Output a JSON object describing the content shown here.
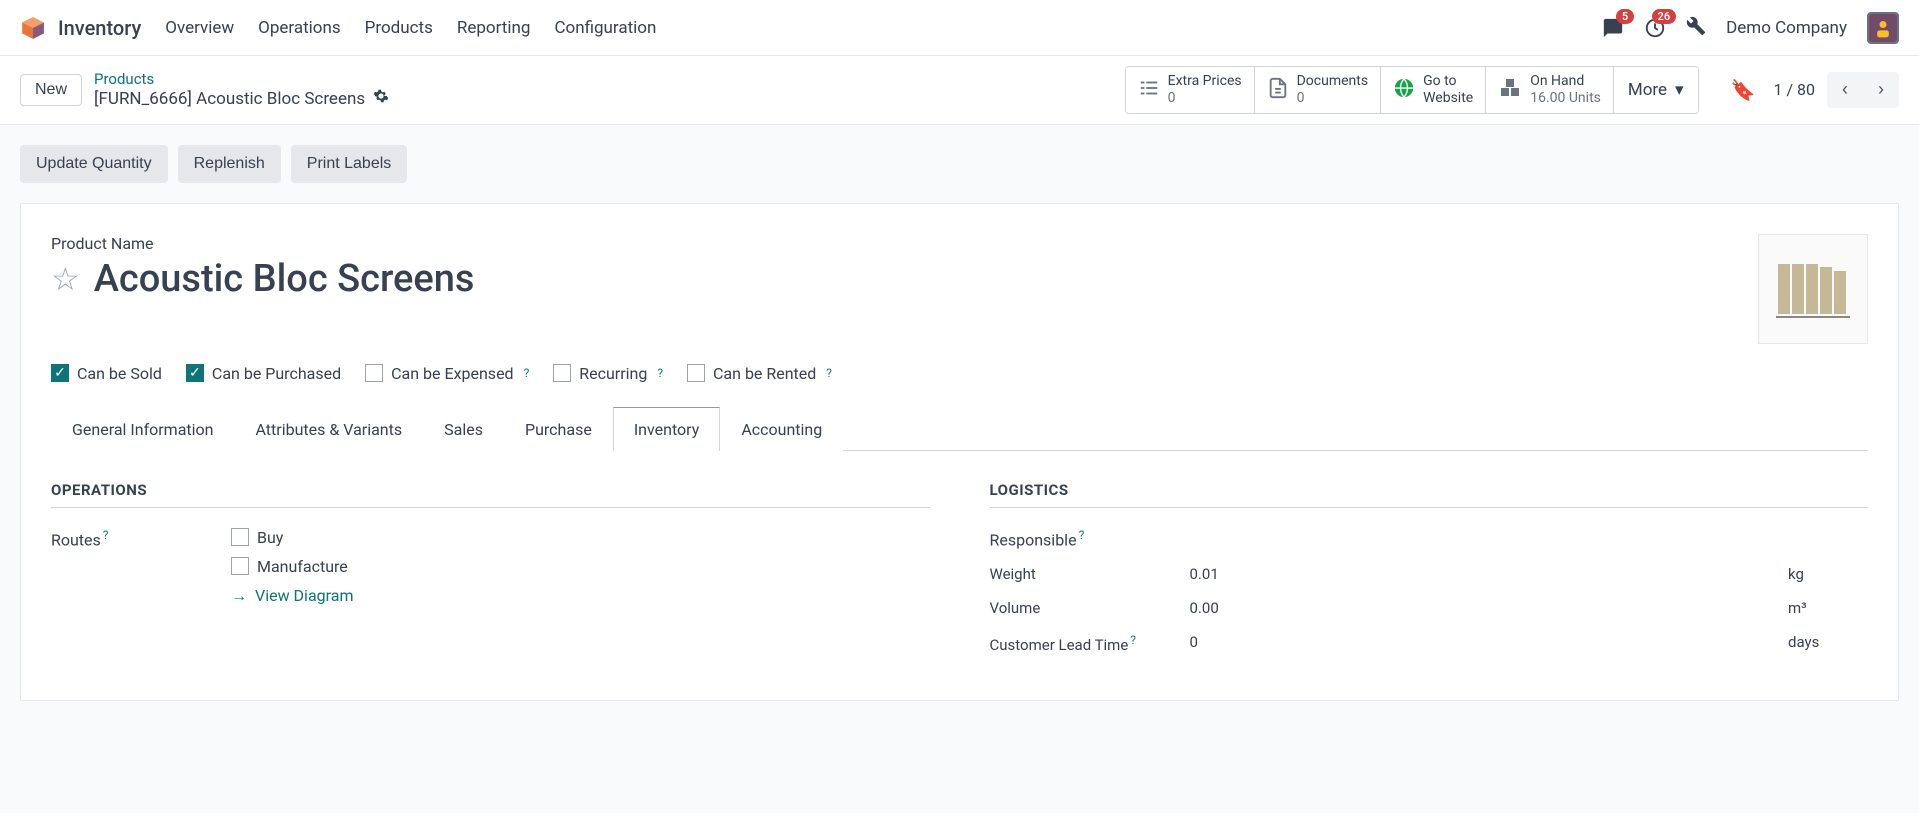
{
  "header": {
    "app_title": "Inventory",
    "nav": [
      "Overview",
      "Operations",
      "Products",
      "Reporting",
      "Configuration"
    ],
    "messages_badge": "5",
    "activities_badge": "26",
    "company": "Demo Company"
  },
  "subbar": {
    "new_label": "New",
    "breadcrumb_parent": "Products",
    "breadcrumb_current": "[FURN_6666] Acoustic Bloc Screens",
    "stats": {
      "extra_prices": {
        "label": "Extra Prices",
        "value": "0"
      },
      "documents": {
        "label": "Documents",
        "value": "0"
      },
      "go_to_website": {
        "label1": "Go to",
        "label2": "Website"
      },
      "on_hand": {
        "label": "On Hand",
        "value": "16.00 Units"
      },
      "more": "More"
    },
    "pager": {
      "info": "1 / 80"
    }
  },
  "actions": [
    "Update Quantity",
    "Replenish",
    "Print Labels"
  ],
  "product": {
    "name_label": "Product Name",
    "name": "Acoustic Bloc Screens",
    "checkboxes": {
      "can_be_sold": {
        "label": "Can be Sold",
        "checked": true
      },
      "can_be_purchased": {
        "label": "Can be Purchased",
        "checked": true
      },
      "can_be_expensed": {
        "label": "Can be Expensed",
        "checked": false,
        "help": true
      },
      "recurring": {
        "label": "Recurring",
        "checked": false,
        "help": true
      },
      "can_be_rented": {
        "label": "Can be Rented",
        "checked": false,
        "help": true
      }
    },
    "tabs": [
      "General Information",
      "Attributes & Variants",
      "Sales",
      "Purchase",
      "Inventory",
      "Accounting"
    ],
    "active_tab": "Inventory"
  },
  "inventory_tab": {
    "operations": {
      "title": "OPERATIONS",
      "routes_label": "Routes",
      "routes": {
        "buy": {
          "label": "Buy",
          "checked": false
        },
        "manufacture": {
          "label": "Manufacture",
          "checked": false
        }
      },
      "view_diagram": "View Diagram"
    },
    "logistics": {
      "title": "LOGISTICS",
      "responsible": {
        "label": "Responsible",
        "value": ""
      },
      "weight": {
        "label": "Weight",
        "value": "0.01",
        "unit": "kg"
      },
      "volume": {
        "label": "Volume",
        "value": "0.00",
        "unit": "m³"
      },
      "lead_time": {
        "label": "Customer Lead Time",
        "value": "0",
        "unit": "days"
      }
    }
  }
}
